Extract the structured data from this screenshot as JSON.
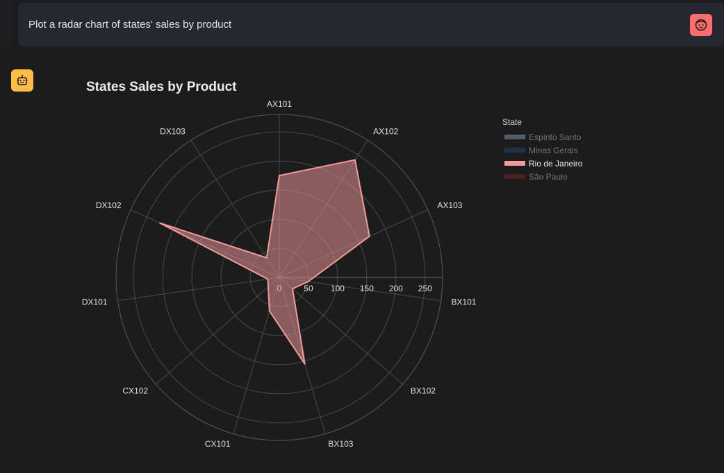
{
  "user_message": {
    "text": "Plot a radar chart of states' sales by product"
  },
  "chart_data": {
    "type": "radar",
    "title": "States Sales by Product",
    "categories": [
      "AX101",
      "AX102",
      "AX103",
      "BX101",
      "BX102",
      "BX103",
      "CX101",
      "CX102",
      "DX101",
      "DX102",
      "DX103"
    ],
    "radial_ticks": [
      "0",
      "50",
      "100",
      "150",
      "200",
      "250"
    ],
    "radial_range": [
      0,
      280
    ],
    "legend": {
      "title": "State",
      "placement": "top-right",
      "items": [
        {
          "name": "Espírito Santo",
          "color": "#7a93a8",
          "visible": false
        },
        {
          "name": "Minas Gerais",
          "color": "#23436b",
          "visible": false
        },
        {
          "name": "Rio de Janeiro",
          "color": "#f39b9b",
          "visible": true
        },
        {
          "name": "São Paulo",
          "color": "#7a2424",
          "visible": false
        }
      ]
    },
    "series": [
      {
        "name": "Rio de Janeiro",
        "values": [
          175,
          240,
          170,
          50,
          30,
          155,
          60,
          25,
          20,
          225,
          40
        ]
      }
    ]
  },
  "colors": {
    "background": "#1c1c1d",
    "grid": "#4a4a4a",
    "fill": "rgba(243,155,155,0.5)",
    "stroke": "#f39b9b"
  }
}
